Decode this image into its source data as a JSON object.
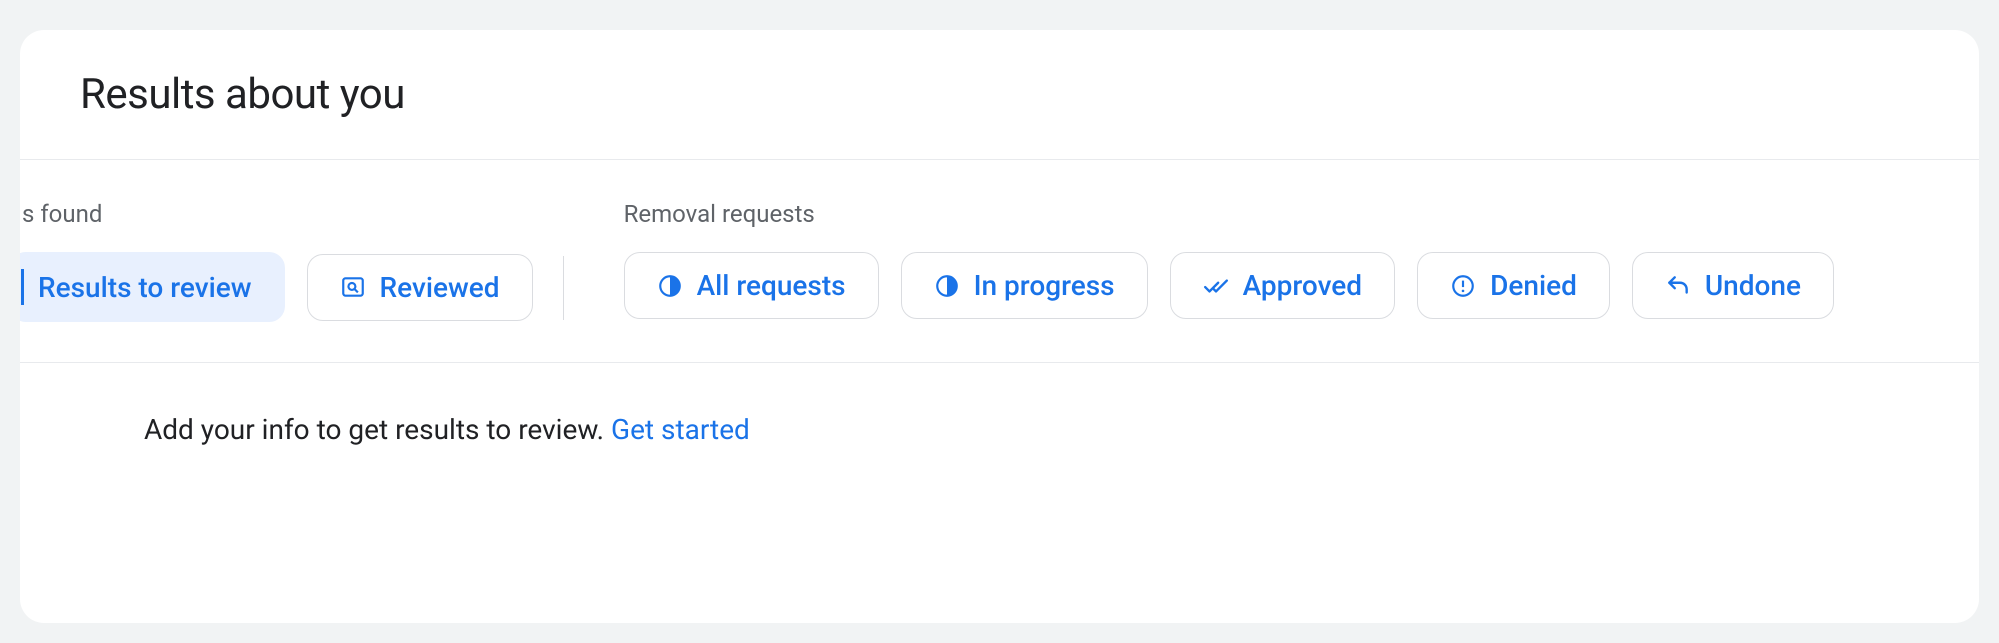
{
  "header": {
    "title": "Results about you"
  },
  "groups": {
    "results": {
      "label": "s found",
      "chips": [
        {
          "label": "Results to review"
        },
        {
          "label": "Reviewed"
        }
      ]
    },
    "removal": {
      "label": "Removal requests",
      "chips": [
        {
          "label": "All requests"
        },
        {
          "label": "In progress"
        },
        {
          "label": "Approved"
        },
        {
          "label": "Denied"
        },
        {
          "label": "Undone"
        }
      ]
    }
  },
  "info": {
    "text": "Add your info to get results to review. ",
    "link_label": "Get started"
  }
}
